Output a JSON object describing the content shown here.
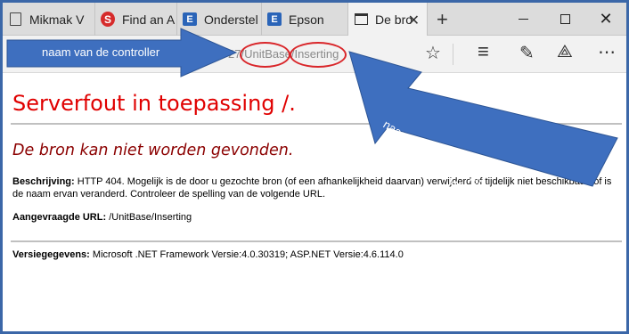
{
  "tabs": [
    {
      "label": "Mikmak V",
      "icon": "page-icon"
    },
    {
      "label": "Find an A",
      "icon": "s-logo-icon"
    },
    {
      "label": "Onderstel",
      "icon": "e-logo-icon"
    },
    {
      "label": "Epson",
      "icon": "e-logo-icon"
    },
    {
      "label": "De bro",
      "icon": "window-icon",
      "active": true
    }
  ],
  "address": {
    "prefix": "27/",
    "controller": "UnitBase",
    "slash": "/",
    "action": "Inserting"
  },
  "annotations": {
    "controller": "naam van de controller",
    "action": "naam van de actiemethode en van de view"
  },
  "page": {
    "title": "Serverfout in toepassing /.",
    "subtitle": "De bron kan niet worden gevonden.",
    "description_label": "Beschrijving:",
    "description_text": "HTTP 404. Mogelijk is de door u gezochte bron (of een afhankelijkheid daarvan) verwijderd of tijdelijk niet beschikbaar, of is de naam ervan veranderd. Controleer de spelling van de volgende URL.",
    "requested_label": "Aangevraagde URL:",
    "requested_url": "/UnitBase/Inserting",
    "version_label": "Versiegegevens:",
    "version_text": "Microsoft .NET Framework Versie:4.0.30319; ASP.NET Versie:4.6.114.0"
  },
  "colors": {
    "accent_arrow": "#3e6fbf",
    "circle": "#d9262a",
    "error_title": "#e00000",
    "error_subtitle": "#8b0000",
    "frame": "#3b67a8"
  }
}
